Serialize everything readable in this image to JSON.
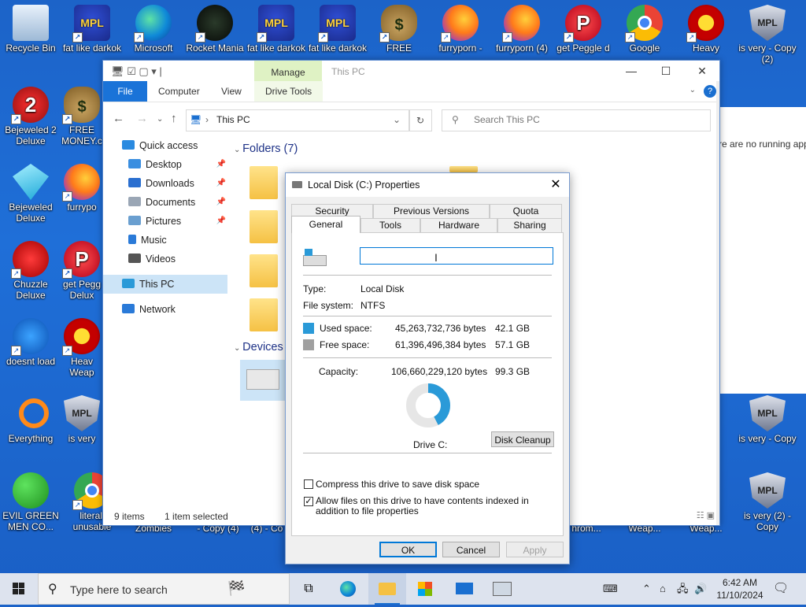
{
  "desktop": {
    "icons": [
      {
        "label": "Recycle Bin"
      },
      {
        "label": "fat like darkok"
      },
      {
        "label": "Microsoft"
      },
      {
        "label": "Rocket Mania"
      },
      {
        "label": "fat like darkok"
      },
      {
        "label": "fat like darkok"
      },
      {
        "label": "FREE"
      },
      {
        "label": "furryporn -"
      },
      {
        "label": "furryporn (4)"
      },
      {
        "label": "get Peggle d"
      },
      {
        "label": "Google"
      },
      {
        "label": "Heavy"
      },
      {
        "label": "is very - Copy (2)"
      },
      {
        "label": "Bejeweled 2 Deluxe"
      },
      {
        "label": "FREE MONEY.c"
      },
      {
        "label": "Bejeweled Deluxe"
      },
      {
        "label": "furrypo"
      },
      {
        "label": "Chuzzle Deluxe"
      },
      {
        "label": "get Pegg Delux"
      },
      {
        "label": "doesnt load"
      },
      {
        "label": "Heav Weap"
      },
      {
        "label": "Everything"
      },
      {
        "label": "is very"
      },
      {
        "label": "is very - Copy"
      },
      {
        "label": "EVIL GREEN MEN CO..."
      },
      {
        "label": "literall unusable"
      },
      {
        "label": "Zombies"
      },
      {
        "label": "- Copy (4)"
      },
      {
        "label": "(4) - Co"
      },
      {
        "label": "hrom..."
      },
      {
        "label": "Weap..."
      },
      {
        "label": "Weap..."
      },
      {
        "label": "is very (2) - Copy"
      }
    ]
  },
  "explorer": {
    "title": "This PC",
    "manage_tab": "Manage",
    "ribbon": {
      "file": "File",
      "computer": "Computer",
      "view": "View",
      "drive_tools": "Drive Tools",
      "help": "?"
    },
    "address": "This PC",
    "search_placeholder": "Search This PC",
    "nav": [
      {
        "label": "Quick access"
      },
      {
        "label": "Desktop"
      },
      {
        "label": "Downloads"
      },
      {
        "label": "Documents"
      },
      {
        "label": "Pictures"
      },
      {
        "label": "Music"
      },
      {
        "label": "Videos"
      },
      {
        "label": "This PC"
      },
      {
        "label": "Network"
      }
    ],
    "sections": {
      "folders": "Folders (7)",
      "devices": "Devices"
    },
    "status": {
      "items": "9 items",
      "selected": "1 item selected"
    }
  },
  "side_window": {
    "text": "re are no running app"
  },
  "dialog": {
    "title": "Local Disk (C:) Properties",
    "tabs_back": [
      "Security",
      "Previous Versions",
      "Quota"
    ],
    "tabs_front": [
      "General",
      "Tools",
      "Hardware",
      "Sharing"
    ],
    "name_value": "",
    "type_label": "Type:",
    "type_value": "Local Disk",
    "fs_label": "File system:",
    "fs_value": "NTFS",
    "used": {
      "label": "Used space:",
      "bytes": "45,263,732,736 bytes",
      "size": "42.1 GB",
      "color": "#2a9ad8"
    },
    "free": {
      "label": "Free space:",
      "bytes": "61,396,496,384 bytes",
      "size": "57.1 GB",
      "color": "#a0a0a0"
    },
    "capacity": {
      "label": "Capacity:",
      "bytes": "106,660,229,120 bytes",
      "size": "99.3 GB"
    },
    "used_fraction": 0.424,
    "drive_label": "Drive C:",
    "disk_cleanup": "Disk Cleanup",
    "compress": {
      "label": "Compress this drive to save disk space",
      "checked": false
    },
    "index": {
      "label": "Allow files on this drive to have contents indexed in addition to file properties",
      "checked": true
    },
    "buttons": {
      "ok": "OK",
      "cancel": "Cancel",
      "apply": "Apply"
    }
  },
  "taskbar": {
    "search_placeholder": "Type here to search",
    "time": "6:42 AM",
    "date": "11/10/2024"
  }
}
